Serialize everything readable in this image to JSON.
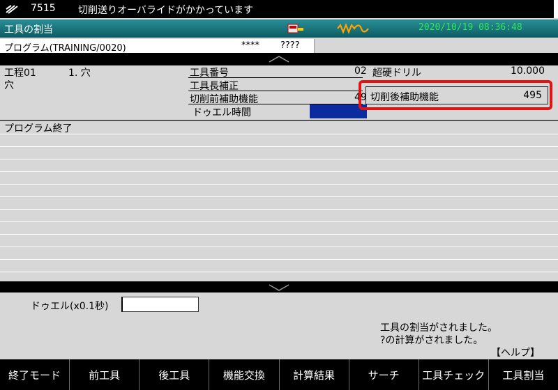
{
  "alarm": {
    "code": "7515",
    "message": "切削送りオーバライドがかかっています"
  },
  "title_bar": {
    "title": "工具の割当",
    "datetime": "2020/10/19 08:36:48"
  },
  "program": {
    "name": "プログラム(TRAINING/0020)",
    "masks": "****",
    "qmarks": "????"
  },
  "process": {
    "step": "工程01",
    "number": "1. 穴",
    "type": "穴",
    "tool_number_label": "工具番号",
    "tool_number_value": "02",
    "tool_name": "超硬ドリル",
    "tool_diameter": "10.000",
    "tool_length_comp_label": "工具長補正",
    "pre_cut_aux_label": "切削前補助機能",
    "pre_cut_aux_value": "49",
    "dwell_label": "ドゥエル時間"
  },
  "highlight": {
    "label": "切削後補助機能",
    "value": "495"
  },
  "list": {
    "rows": [
      "プログラム終了",
      "",
      "",
      "",
      "",
      "",
      "",
      "",
      "",
      "",
      "",
      "",
      ""
    ]
  },
  "input": {
    "label": "ドゥエル(x0.1秒)",
    "value": ""
  },
  "messages": {
    "line1": "工具の割当がされました。",
    "line2": "?の計算がされました。",
    "help": "【ヘルプ】"
  },
  "function_keys": [
    "終了モード",
    "前工具",
    "後工具",
    "機能交換",
    "計算結果",
    "サーチ",
    "工具チェック",
    "工具割当"
  ],
  "colors": {
    "title_bar": "#1a7a82",
    "datetime": "#2ee855",
    "dwell_field": "#0b2b9e",
    "highlight_border": "#e01414"
  },
  "icons": {
    "menu": "menu-stripes-icon",
    "status1": "tool-status-icon",
    "status2": "spindle-wave-icon",
    "scroll_up": "chevron-up-icon",
    "scroll_down": "chevron-down-icon"
  }
}
